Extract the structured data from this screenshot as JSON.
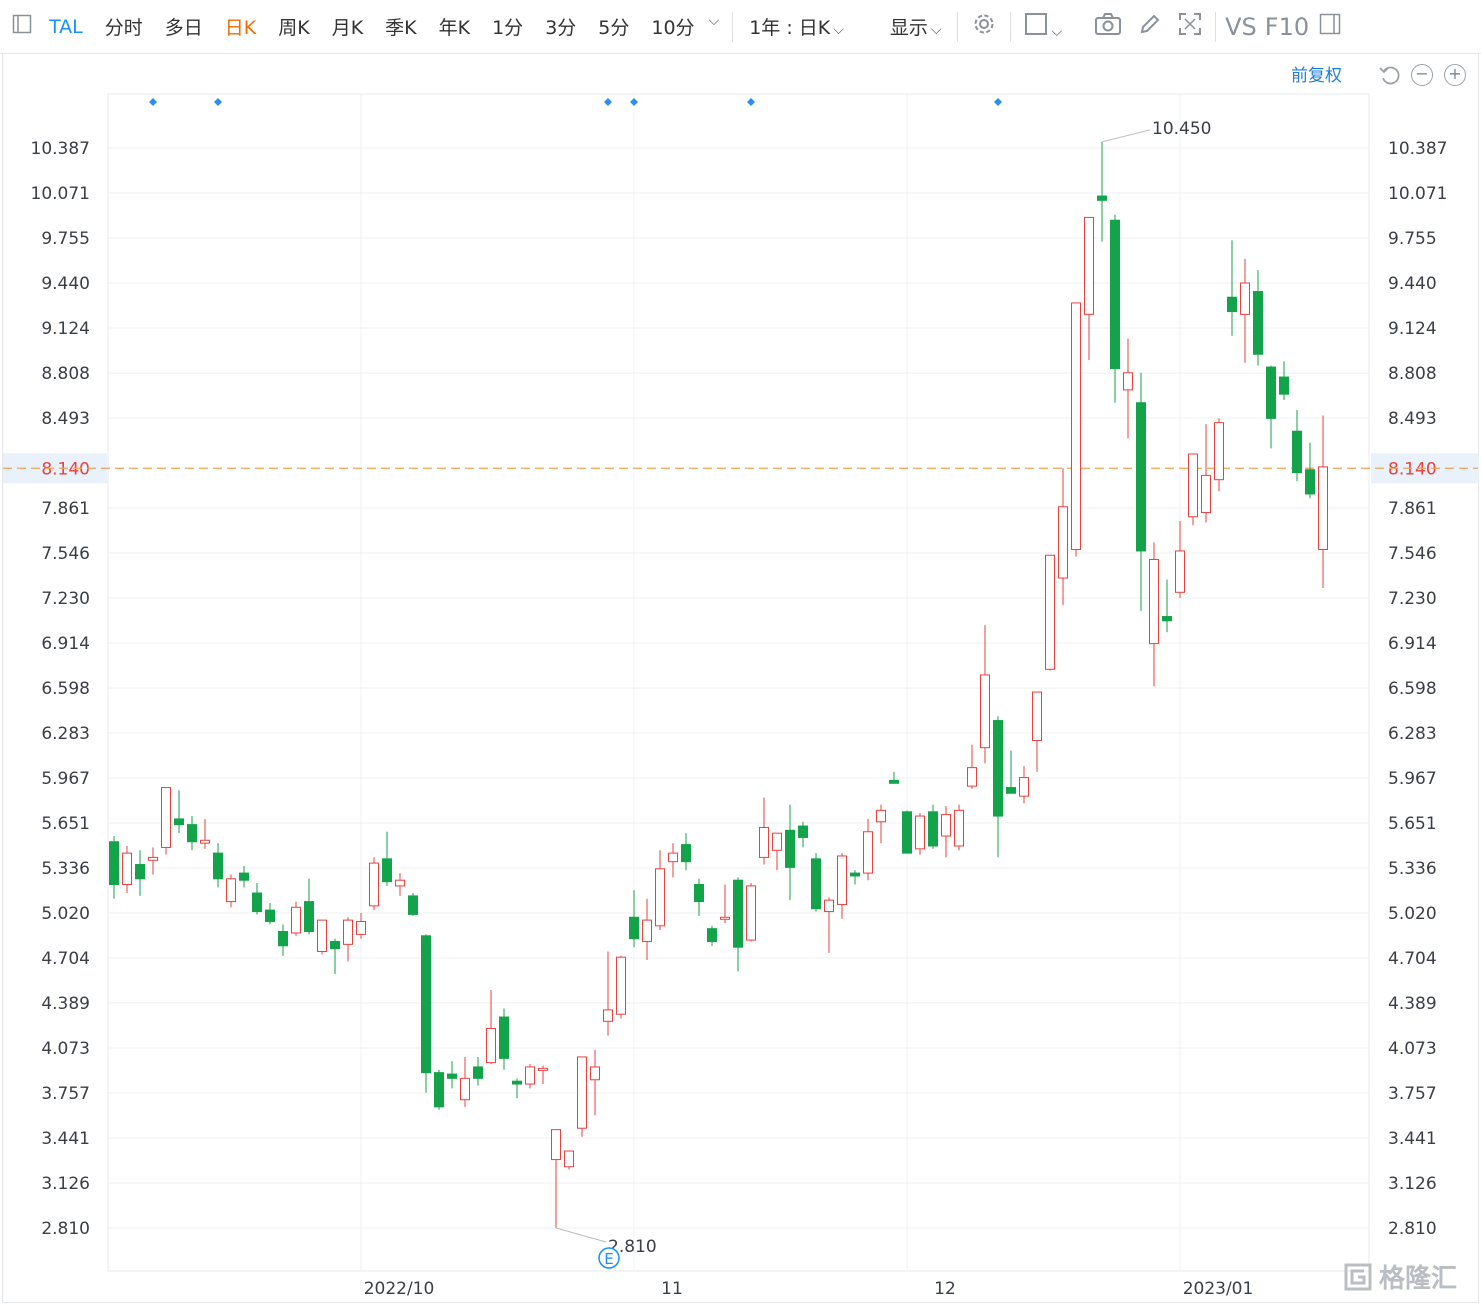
{
  "toolbar": {
    "symbol": "TAL",
    "tabs": [
      "分时",
      "多日",
      "日K",
      "周K",
      "月K",
      "季K",
      "年K",
      "1分",
      "3分",
      "5分",
      "10分"
    ],
    "active_tab": "日K",
    "period_select": "1年 : 日K",
    "display_label": "显示",
    "vs_label": "VS",
    "f10_label": "F10"
  },
  "adjust_label": "前复权",
  "watermark": "格隆汇",
  "colors": {
    "up": "#e8413e",
    "down": "#13a34a",
    "accent": "#1890ff",
    "current_line": "#f0a258",
    "current_text": "#e8413e",
    "grid": "#eef0f3"
  },
  "chart_data": {
    "type": "candlestick",
    "y_ticks": [
      "10.387",
      "10.071",
      "9.755",
      "9.440",
      "9.124",
      "8.808",
      "8.493",
      "8.140",
      "7.861",
      "7.546",
      "7.230",
      "6.914",
      "6.598",
      "6.283",
      "5.967",
      "5.651",
      "5.336",
      "5.020",
      "4.704",
      "4.389",
      "4.073",
      "3.757",
      "3.441",
      "3.126",
      "2.810"
    ],
    "ylim": [
      2.5,
      10.7
    ],
    "x_labels": [
      {
        "label": "2022/10",
        "index": 19
      },
      {
        "label": "11",
        "index": 40
      },
      {
        "label": "12",
        "index": 61
      },
      {
        "label": "2023/01",
        "index": 82
      }
    ],
    "current_price": "8.140",
    "max_label": "10.450",
    "min_label": "2.810",
    "event_marker": "E",
    "event_index": 38,
    "dividend_markers": [
      3,
      8,
      38,
      40,
      49,
      68
    ],
    "candles": [
      {
        "o": 5.52,
        "h": 5.56,
        "l": 5.12,
        "c": 5.22
      },
      {
        "o": 5.22,
        "h": 5.49,
        "l": 5.16,
        "c": 5.44
      },
      {
        "o": 5.36,
        "h": 5.46,
        "l": 5.14,
        "c": 5.26
      },
      {
        "o": 5.39,
        "h": 5.48,
        "l": 5.29,
        "c": 5.41
      },
      {
        "o": 5.48,
        "h": 5.9,
        "l": 5.43,
        "c": 5.9
      },
      {
        "o": 5.68,
        "h": 5.88,
        "l": 5.58,
        "c": 5.64
      },
      {
        "o": 5.64,
        "h": 5.7,
        "l": 5.46,
        "c": 5.52
      },
      {
        "o": 5.51,
        "h": 5.68,
        "l": 5.47,
        "c": 5.53
      },
      {
        "o": 5.44,
        "h": 5.51,
        "l": 5.2,
        "c": 5.26
      },
      {
        "o": 5.1,
        "h": 5.29,
        "l": 5.06,
        "c": 5.26
      },
      {
        "o": 5.3,
        "h": 5.35,
        "l": 5.2,
        "c": 5.25
      },
      {
        "o": 5.16,
        "h": 5.23,
        "l": 5.01,
        "c": 5.03
      },
      {
        "o": 5.04,
        "h": 5.09,
        "l": 4.94,
        "c": 4.96
      },
      {
        "o": 4.89,
        "h": 4.94,
        "l": 4.72,
        "c": 4.79
      },
      {
        "o": 4.88,
        "h": 5.1,
        "l": 4.86,
        "c": 5.06
      },
      {
        "o": 5.1,
        "h": 5.26,
        "l": 4.87,
        "c": 4.89
      },
      {
        "o": 4.75,
        "h": 4.97,
        "l": 4.73,
        "c": 4.97
      },
      {
        "o": 4.82,
        "h": 4.84,
        "l": 4.59,
        "c": 4.77
      },
      {
        "o": 4.8,
        "h": 4.99,
        "l": 4.68,
        "c": 4.97
      },
      {
        "o": 4.87,
        "h": 5.02,
        "l": 4.84,
        "c": 4.96
      },
      {
        "o": 5.07,
        "h": 5.41,
        "l": 5.04,
        "c": 5.37
      },
      {
        "o": 5.4,
        "h": 5.59,
        "l": 5.21,
        "c": 5.24
      },
      {
        "o": 5.21,
        "h": 5.3,
        "l": 5.14,
        "c": 5.25
      },
      {
        "o": 5.14,
        "h": 5.16,
        "l": 5.0,
        "c": 5.01
      },
      {
        "o": 4.86,
        "h": 4.87,
        "l": 3.76,
        "c": 3.9
      },
      {
        "o": 3.9,
        "h": 3.92,
        "l": 3.64,
        "c": 3.66
      },
      {
        "o": 3.89,
        "h": 3.98,
        "l": 3.79,
        "c": 3.86
      },
      {
        "o": 3.71,
        "h": 4.01,
        "l": 3.66,
        "c": 3.86
      },
      {
        "o": 3.94,
        "h": 4.01,
        "l": 3.81,
        "c": 3.86
      },
      {
        "o": 3.97,
        "h": 4.48,
        "l": 3.96,
        "c": 4.21
      },
      {
        "o": 4.29,
        "h": 4.35,
        "l": 3.92,
        "c": 4.0
      },
      {
        "o": 3.84,
        "h": 3.86,
        "l": 3.72,
        "c": 3.82
      },
      {
        "o": 3.82,
        "h": 3.96,
        "l": 3.79,
        "c": 3.94
      },
      {
        "o": 3.92,
        "h": 3.95,
        "l": 3.82,
        "c": 3.93
      },
      {
        "o": 3.29,
        "h": 3.5,
        "l": 2.81,
        "c": 3.5
      },
      {
        "o": 3.24,
        "h": 3.35,
        "l": 3.22,
        "c": 3.35
      },
      {
        "o": 3.51,
        "h": 4.01,
        "l": 3.45,
        "c": 4.01
      },
      {
        "o": 3.85,
        "h": 4.06,
        "l": 3.6,
        "c": 3.94
      },
      {
        "o": 4.26,
        "h": 4.75,
        "l": 4.16,
        "c": 4.34
      },
      {
        "o": 4.31,
        "h": 4.72,
        "l": 4.28,
        "c": 4.71
      },
      {
        "o": 4.99,
        "h": 5.18,
        "l": 4.78,
        "c": 4.84
      },
      {
        "o": 4.82,
        "h": 5.12,
        "l": 4.69,
        "c": 4.97
      },
      {
        "o": 4.93,
        "h": 5.46,
        "l": 4.9,
        "c": 5.33
      },
      {
        "o": 5.38,
        "h": 5.51,
        "l": 5.27,
        "c": 5.44
      },
      {
        "o": 5.5,
        "h": 5.58,
        "l": 5.32,
        "c": 5.38
      },
      {
        "o": 5.22,
        "h": 5.26,
        "l": 5.0,
        "c": 5.1
      },
      {
        "o": 4.91,
        "h": 4.93,
        "l": 4.79,
        "c": 4.82
      },
      {
        "o": 4.99,
        "h": 5.22,
        "l": 4.95,
        "c": 4.99
      },
      {
        "o": 5.25,
        "h": 5.27,
        "l": 4.61,
        "c": 4.78
      },
      {
        "o": 4.83,
        "h": 5.23,
        "l": 4.82,
        "c": 5.21
      },
      {
        "o": 5.41,
        "h": 5.83,
        "l": 5.36,
        "c": 5.62
      },
      {
        "o": 5.46,
        "h": 5.55,
        "l": 5.32,
        "c": 5.58
      },
      {
        "o": 5.6,
        "h": 5.78,
        "l": 5.11,
        "c": 5.34
      },
      {
        "o": 5.63,
        "h": 5.66,
        "l": 5.48,
        "c": 5.55
      },
      {
        "o": 5.4,
        "h": 5.44,
        "l": 5.03,
        "c": 5.05
      },
      {
        "o": 5.03,
        "h": 5.13,
        "l": 4.74,
        "c": 5.11
      },
      {
        "o": 5.08,
        "h": 5.44,
        "l": 4.98,
        "c": 5.42
      },
      {
        "o": 5.3,
        "h": 5.32,
        "l": 5.22,
        "c": 5.28
      },
      {
        "o": 5.3,
        "h": 5.68,
        "l": 5.25,
        "c": 5.59
      },
      {
        "o": 5.66,
        "h": 5.78,
        "l": 5.51,
        "c": 5.74
      },
      {
        "o": 5.95,
        "h": 6.01,
        "l": 5.94,
        "c": 5.93
      },
      {
        "o": 5.73,
        "h": 5.74,
        "l": 5.44,
        "c": 5.44
      },
      {
        "o": 5.47,
        "h": 5.72,
        "l": 5.43,
        "c": 5.7
      },
      {
        "o": 5.73,
        "h": 5.78,
        "l": 5.47,
        "c": 5.49
      },
      {
        "o": 5.56,
        "h": 5.77,
        "l": 5.41,
        "c": 5.71
      },
      {
        "o": 5.49,
        "h": 5.78,
        "l": 5.46,
        "c": 5.74
      },
      {
        "o": 5.91,
        "h": 6.2,
        "l": 5.89,
        "c": 6.04
      },
      {
        "o": 6.18,
        "h": 7.04,
        "l": 6.07,
        "c": 6.69
      },
      {
        "o": 6.37,
        "h": 6.4,
        "l": 5.41,
        "c": 5.7
      },
      {
        "o": 5.9,
        "h": 6.16,
        "l": 5.87,
        "c": 5.86
      },
      {
        "o": 5.84,
        "h": 6.05,
        "l": 5.79,
        "c": 5.97
      },
      {
        "o": 6.23,
        "h": 6.54,
        "l": 6.01,
        "c": 6.57
      },
      {
        "o": 6.73,
        "h": 7.53,
        "l": 6.72,
        "c": 7.53
      },
      {
        "o": 7.37,
        "h": 8.14,
        "l": 7.18,
        "c": 7.87
      },
      {
        "o": 7.57,
        "h": 7.92,
        "l": 7.52,
        "c": 9.3
      },
      {
        "o": 9.22,
        "h": 9.71,
        "l": 8.9,
        "c": 9.9
      },
      {
        "o": 10.05,
        "h": 10.43,
        "l": 9.73,
        "c": 10.02
      },
      {
        "o": 9.88,
        "h": 9.92,
        "l": 8.6,
        "c": 8.84
      },
      {
        "o": 8.69,
        "h": 9.05,
        "l": 8.35,
        "c": 8.81
      },
      {
        "o": 8.6,
        "h": 8.81,
        "l": 7.14,
        "c": 7.56
      },
      {
        "o": 6.91,
        "h": 7.62,
        "l": 6.61,
        "c": 7.5
      },
      {
        "o": 7.1,
        "h": 7.36,
        "l": 6.99,
        "c": 7.07
      },
      {
        "o": 7.27,
        "h": 7.77,
        "l": 7.23,
        "c": 7.56
      },
      {
        "o": 7.8,
        "h": 8.08,
        "l": 7.74,
        "c": 8.24
      },
      {
        "o": 7.83,
        "h": 8.45,
        "l": 7.76,
        "c": 8.09
      },
      {
        "o": 8.06,
        "h": 8.49,
        "l": 7.98,
        "c": 8.46
      },
      {
        "o": 9.34,
        "h": 9.74,
        "l": 9.07,
        "c": 9.24
      },
      {
        "o": 9.22,
        "h": 9.61,
        "l": 8.88,
        "c": 9.44
      },
      {
        "o": 9.38,
        "h": 9.53,
        "l": 8.86,
        "c": 8.94
      },
      {
        "o": 8.85,
        "h": 8.86,
        "l": 8.28,
        "c": 8.49
      },
      {
        "o": 8.78,
        "h": 8.89,
        "l": 8.62,
        "c": 8.66
      },
      {
        "o": 8.4,
        "h": 8.55,
        "l": 8.05,
        "c": 8.11
      },
      {
        "o": 8.13,
        "h": 8.32,
        "l": 7.93,
        "c": 7.96
      },
      {
        "o": 7.57,
        "h": 8.51,
        "l": 7.3,
        "c": 8.15
      }
    ]
  }
}
